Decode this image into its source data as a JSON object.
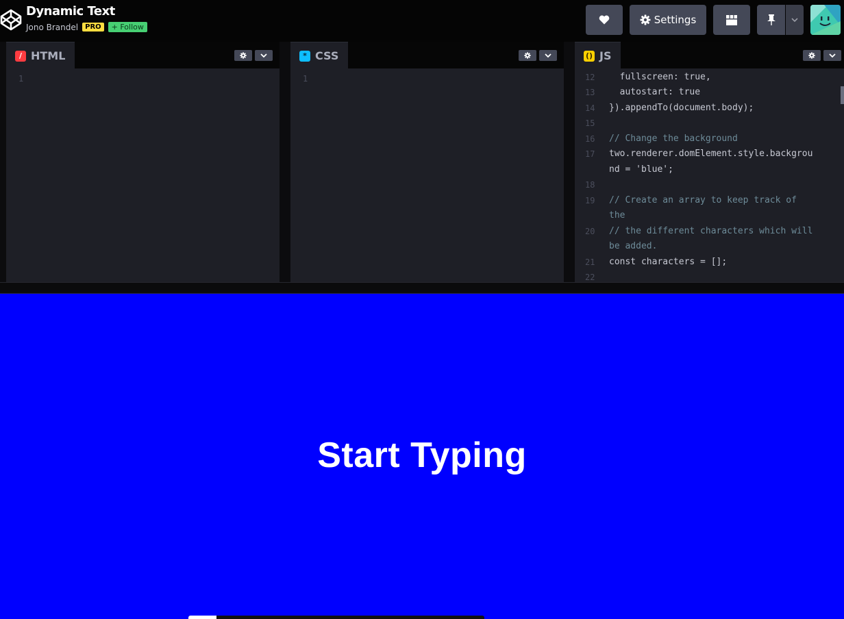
{
  "header": {
    "title": "Dynamic Text",
    "author": "Jono Brandel",
    "pro_badge": "PRO",
    "follow_label": "+ Follow",
    "settings_label": "Settings"
  },
  "panels": {
    "html": {
      "label": "HTML",
      "lines": [
        "1"
      ]
    },
    "css": {
      "label": "CSS",
      "lines": [
        "1"
      ]
    },
    "js": {
      "label": "JS",
      "gutter": [
        "12",
        "13",
        "14",
        "15",
        "16",
        "17",
        "18",
        "19",
        "20",
        "21",
        "22"
      ],
      "code": {
        "l12": "  fullscreen: true,",
        "l13": "  autostart: true",
        "l14": "}).appendTo(document.body);",
        "l16": "// Change the background",
        "l17a": "two.renderer.domElement.style.backgrou",
        "l17b": "nd = 'blue';",
        "l19a": "// Create an array to keep track of",
        "l19b": "the",
        "l20a": "// the different characters which will",
        "l20b": "be added.",
        "l21": "const characters = [];"
      }
    }
  },
  "preview": {
    "text": "Start Typing",
    "background": "#0000ff"
  },
  "colors": {
    "html_icon": "#ff3c41",
    "css_icon": "#0ebeff",
    "js_icon": "#fcd000",
    "button_bg": "#444857"
  },
  "icons": [
    "codepen-logo-icon",
    "heart-icon",
    "gear-icon",
    "layout-icon",
    "pin-icon",
    "chevron-down-icon"
  ]
}
